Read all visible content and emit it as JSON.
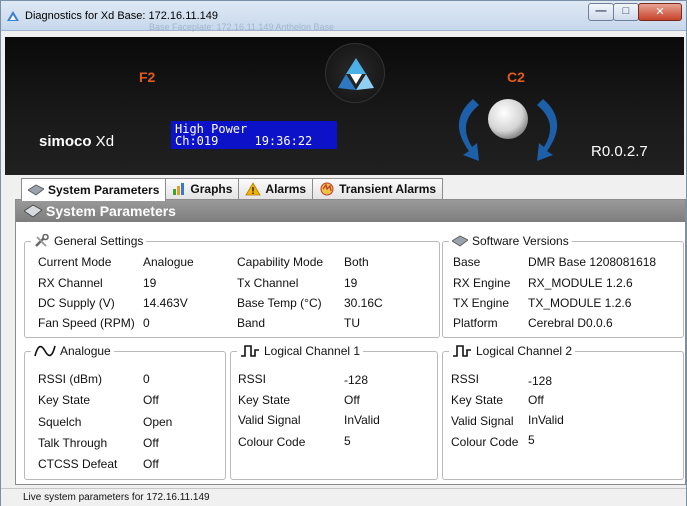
{
  "window": {
    "title": "Diagnostics for Xd Base: 172.16.11.149",
    "ghost_title": "Base Faceplate: 172.16.11.149 Anthelon Base"
  },
  "device": {
    "f_label": "F2",
    "c_label": "C2",
    "brand_first": "simoco",
    "brand_second": " Xd",
    "lcd_line1": "High Power",
    "lcd_line2_left": "Ch:019",
    "lcd_line2_right": "19:36:22",
    "version": "R0.0.2.7"
  },
  "tabs": [
    {
      "label": "System Parameters",
      "icon": "system-params-icon"
    },
    {
      "label": "Graphs",
      "icon": "graphs-icon"
    },
    {
      "label": "Alarms",
      "icon": "alarm-warning-icon"
    },
    {
      "label": "Transient Alarms",
      "icon": "transient-alarms-icon"
    }
  ],
  "panel": {
    "title": "System Parameters"
  },
  "general": {
    "legend": "General Settings",
    "left": [
      {
        "label": "Current Mode",
        "value": "Analogue"
      },
      {
        "label": "RX Channel",
        "value": "19"
      },
      {
        "label": "DC Supply (V)",
        "value": "14.463V"
      },
      {
        "label": "Fan Speed (RPM)",
        "value": "0"
      }
    ],
    "right": [
      {
        "label": "Capability Mode",
        "value": "Both"
      },
      {
        "label": "Tx Channel",
        "value": "19"
      },
      {
        "label": "Base Temp (°C)",
        "value": "30.16C"
      },
      {
        "label": "Band",
        "value": "TU"
      }
    ]
  },
  "software": {
    "legend": "Software Versions",
    "rows": [
      {
        "label": "Base",
        "value": "DMR Base 1208081618"
      },
      {
        "label": "RX Engine",
        "value": "RX_MODULE 1.2.6"
      },
      {
        "label": "TX Engine",
        "value": "TX_MODULE 1.2.6"
      },
      {
        "label": "Platform",
        "value": "Cerebral D0.0.6"
      }
    ]
  },
  "analogue": {
    "legend": "Analogue",
    "rows": [
      {
        "label": "RSSI (dBm)",
        "value": "0"
      },
      {
        "label": "Key State",
        "value": "Off"
      },
      {
        "label": "Squelch",
        "value": "Open"
      },
      {
        "label": "Talk Through",
        "value": "Off"
      },
      {
        "label": "CTCSS Defeat",
        "value": "Off"
      }
    ]
  },
  "lc1": {
    "legend": "Logical Channel 1",
    "rows": [
      {
        "label": "RSSI",
        "value": "-128"
      },
      {
        "label": "Key State",
        "value": "Off"
      },
      {
        "label": "Valid Signal",
        "value": "InValid"
      },
      {
        "label": "Colour Code",
        "value": "5"
      }
    ]
  },
  "lc2": {
    "legend": "Logical Channel 2",
    "rows": [
      {
        "label": "RSSI",
        "value": "-128"
      },
      {
        "label": "Key State",
        "value": "Off"
      },
      {
        "label": "Valid Signal",
        "value": "InValid"
      },
      {
        "label": "Colour Code",
        "value": "5"
      }
    ]
  },
  "status": {
    "text": "Live system parameters for 172.16.11.149"
  },
  "colors": {
    "accent_orange": "#e05a1a",
    "lcd_blue": "#0b12c8",
    "knob_arrow_blue": "#1d5fa8",
    "panel_header": "#8a8a8a"
  }
}
